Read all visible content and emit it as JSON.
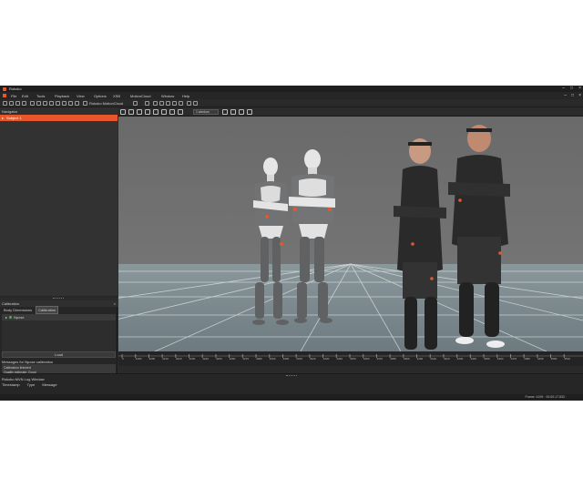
{
  "window": {
    "title": "Rokoko"
  },
  "menu": [
    "File",
    "Edit",
    "Tools",
    "Playback",
    "View",
    "Options",
    "XSB",
    "MotionCloud",
    "Window",
    "Help"
  ],
  "toolbar": {
    "motioncloud_label": "Rokoko MotionCloud"
  },
  "navigator": {
    "title": "Navigator",
    "subject": "Subject 1"
  },
  "calibration": {
    "title": "Calibration",
    "tabs": [
      "Body Dimensions",
      "Calibration"
    ],
    "pose": "Npose",
    "load_button": "Load",
    "messages_title": "Messages for Npose calibration",
    "messages": [
      "Calibration finished",
      "Quality estimate: Good"
    ]
  },
  "viewport": {
    "selector": "1 window"
  },
  "timeline": {
    "labels": [
      "0",
      "4190",
      "4200",
      "4210",
      "4220",
      "4230",
      "4240",
      "4250",
      "4260",
      "4270",
      "4280",
      "4290",
      "4300",
      "4310",
      "4320",
      "4330",
      "4340",
      "4350",
      "4360",
      "4370",
      "4380",
      "4390",
      "4400",
      "4410",
      "4420",
      "4430",
      "4440",
      "4450",
      "4460",
      "4470",
      "4480",
      "4490",
      "4500",
      "4510"
    ]
  },
  "log": {
    "title": "Rokoko MVN Log Window",
    "columns": [
      "Timestamp",
      "Type",
      "Message"
    ]
  },
  "status": {
    "text": "Frame: 4195  ·  00:00:17.833 ·"
  },
  "colors": {
    "accent": "#e8572a",
    "panel": "#262626",
    "sky": "#707070",
    "floor": "#7f8d92"
  }
}
